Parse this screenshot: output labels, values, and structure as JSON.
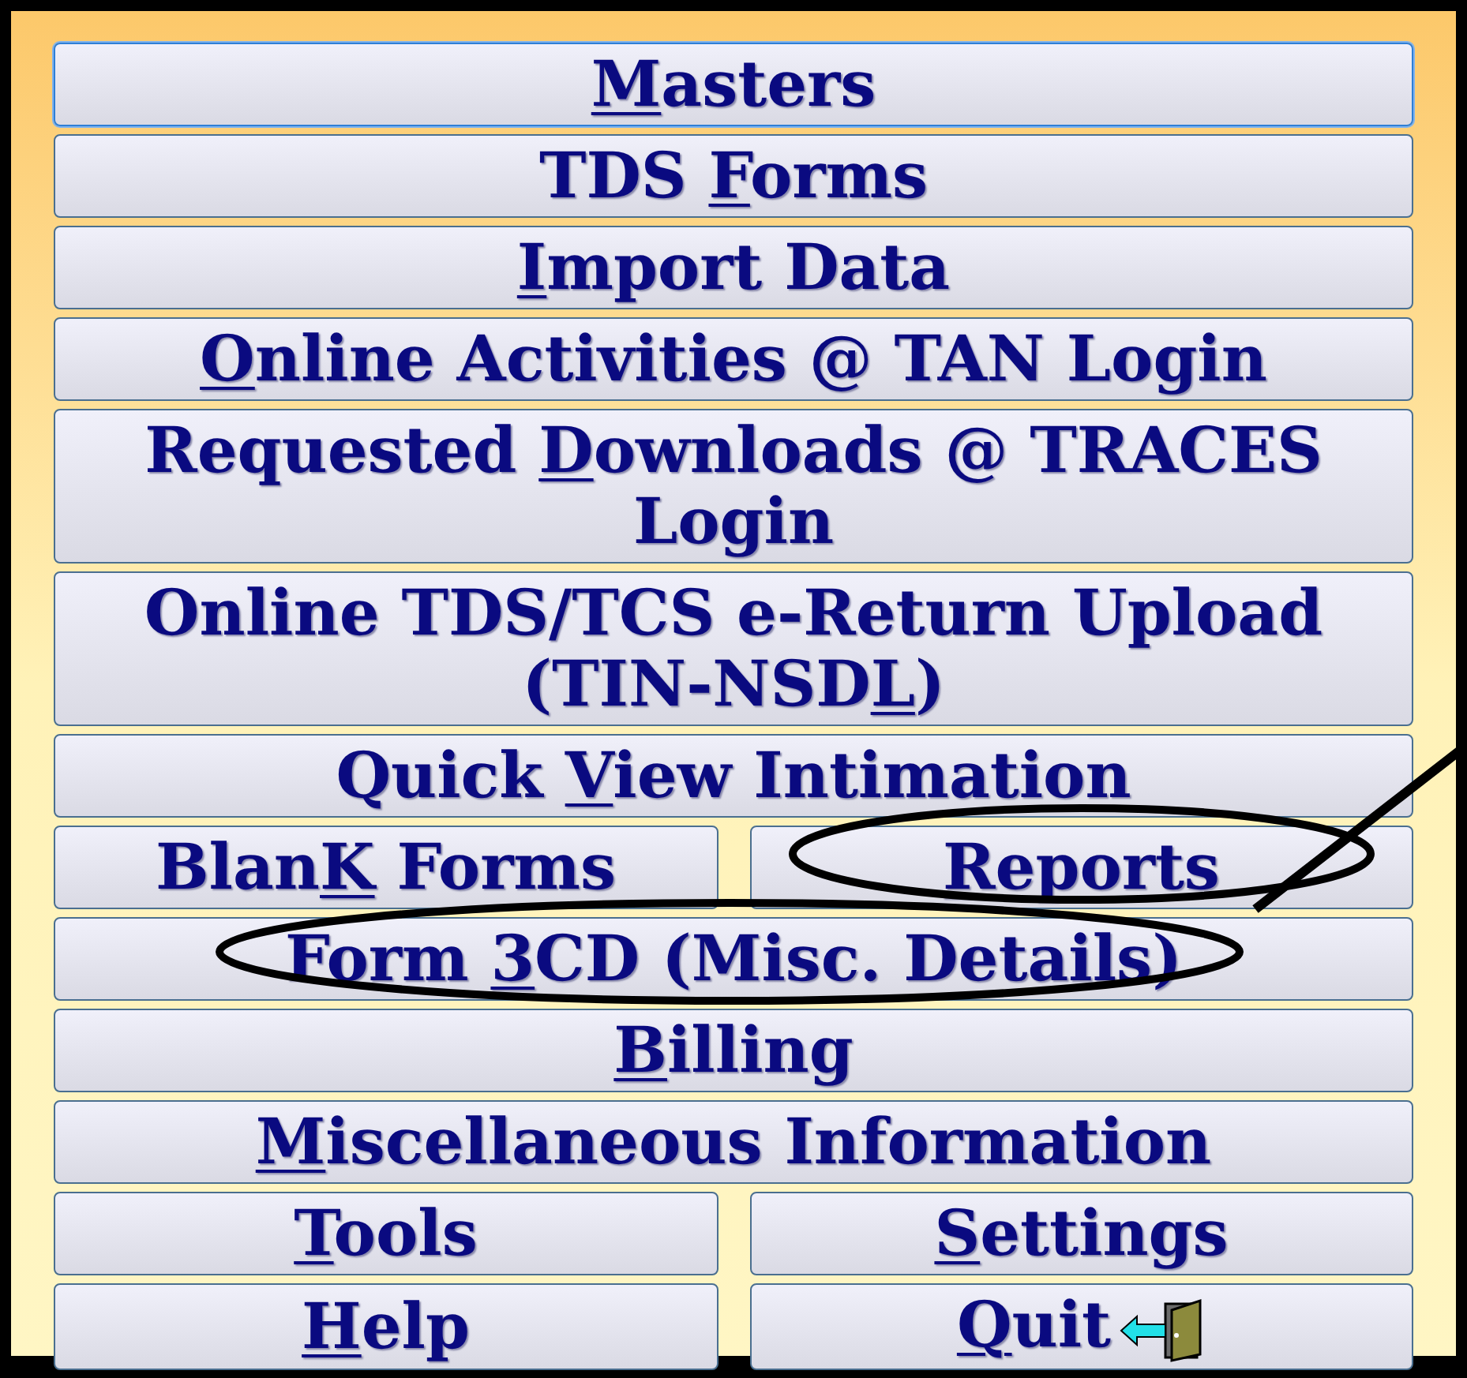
{
  "menu_rows": [
    {
      "buttons": [
        {
          "label": [
            {
              "text": "M",
              "underlined": true
            },
            {
              "text": "asters",
              "underlined": false
            }
          ],
          "kind": "plain",
          "focused": true
        }
      ]
    },
    {
      "buttons": [
        {
          "label": [
            {
              "text": "TDS ",
              "underlined": false
            },
            {
              "text": "F",
              "underlined": true
            },
            {
              "text": "orms",
              "underlined": false
            }
          ],
          "kind": "plain",
          "focused": false
        }
      ]
    },
    {
      "buttons": [
        {
          "label": [
            {
              "text": "I",
              "underlined": true
            },
            {
              "text": "mport Data",
              "underlined": false
            }
          ],
          "kind": "plain",
          "focused": false
        }
      ]
    },
    {
      "buttons": [
        {
          "label": [
            {
              "text": "O",
              "underlined": true
            },
            {
              "text": "nline Activities @ TAN Login",
              "underlined": false
            }
          ],
          "kind": "plain",
          "focused": false
        }
      ]
    },
    {
      "buttons": [
        {
          "label": [
            {
              "text": "Requested ",
              "underlined": false
            },
            {
              "text": "D",
              "underlined": true
            },
            {
              "text": "ownloads @ TRACES Login",
              "underlined": false
            }
          ],
          "kind": "plain",
          "focused": false
        }
      ]
    },
    {
      "buttons": [
        {
          "label": [
            {
              "text": "Online TDS/TCS e-Return Upload (TIN-NSD",
              "underlined": false
            },
            {
              "text": "L",
              "underlined": true
            },
            {
              "text": ")",
              "underlined": false
            }
          ],
          "kind": "plain",
          "focused": false
        }
      ]
    },
    {
      "buttons": [
        {
          "label": [
            {
              "text": "Quick ",
              "underlined": false
            },
            {
              "text": "V",
              "underlined": true
            },
            {
              "text": "iew Intimation",
              "underlined": false
            }
          ],
          "kind": "plain",
          "focused": false
        }
      ]
    },
    {
      "buttons": [
        {
          "label": [
            {
              "text": "Blan",
              "underlined": false
            },
            {
              "text": "K",
              "underlined": true
            },
            {
              "text": " Forms",
              "underlined": false
            }
          ],
          "kind": "plain",
          "focused": false
        },
        {
          "label": [
            {
              "text": "R",
              "underlined": true
            },
            {
              "text": "eports",
              "underlined": false
            }
          ],
          "kind": "plain",
          "focused": false
        }
      ]
    },
    {
      "buttons": [
        {
          "label": [
            {
              "text": "Form ",
              "underlined": false
            },
            {
              "text": "3",
              "underlined": true
            },
            {
              "text": "CD (Misc. Details)",
              "underlined": false
            }
          ],
          "kind": "plain",
          "focused": false
        }
      ]
    },
    {
      "buttons": [
        {
          "label": [
            {
              "text": "B",
              "underlined": true
            },
            {
              "text": "illing",
              "underlined": false
            }
          ],
          "kind": "plain",
          "focused": false
        }
      ]
    },
    {
      "buttons": [
        {
          "label": [
            {
              "text": "M",
              "underlined": true
            },
            {
              "text": "iscellaneous Information",
              "underlined": false
            }
          ],
          "kind": "plain",
          "focused": false
        }
      ]
    },
    {
      "buttons": [
        {
          "label": [
            {
              "text": "T",
              "underlined": true
            },
            {
              "text": "ools",
              "underlined": false
            }
          ],
          "kind": "plain",
          "focused": false
        },
        {
          "label": [
            {
              "text": "S",
              "underlined": true
            },
            {
              "text": "ettings",
              "underlined": false
            }
          ],
          "kind": "plain",
          "focused": false
        }
      ]
    },
    {
      "buttons": [
        {
          "label": [
            {
              "text": "H",
              "underlined": true
            },
            {
              "text": "elp",
              "underlined": false
            }
          ],
          "kind": "plain",
          "focused": false
        },
        {
          "label": [
            {
              "text": "Q",
              "underlined": true
            },
            {
              "text": "uit",
              "underlined": false
            }
          ],
          "kind": "exit",
          "focused": false
        }
      ]
    }
  ]
}
